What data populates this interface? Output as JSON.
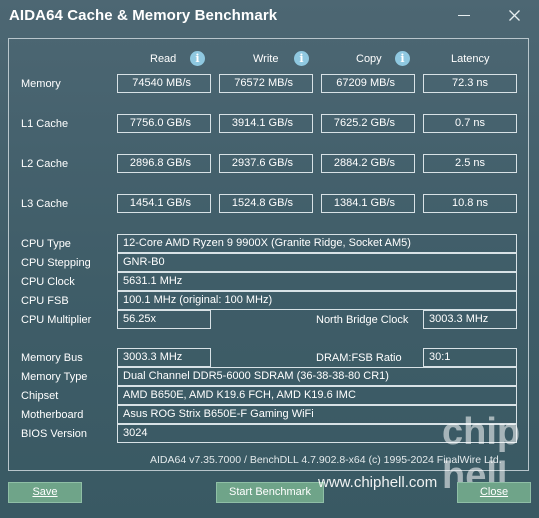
{
  "window": {
    "title": "AIDA64 Cache & Memory Benchmark"
  },
  "columns": {
    "read": "Read",
    "write": "Write",
    "copy": "Copy",
    "latency": "Latency"
  },
  "rows": [
    {
      "label": "Memory",
      "read": "74540 MB/s",
      "write": "76572 MB/s",
      "copy": "67209 MB/s",
      "latency": "72.3 ns"
    },
    {
      "label": "L1 Cache",
      "read": "7756.0 GB/s",
      "write": "3914.1 GB/s",
      "copy": "7625.2 GB/s",
      "latency": "0.7 ns"
    },
    {
      "label": "L2 Cache",
      "read": "2896.8 GB/s",
      "write": "2937.6 GB/s",
      "copy": "2884.2 GB/s",
      "latency": "2.5 ns"
    },
    {
      "label": "L3 Cache",
      "read": "1454.1 GB/s",
      "write": "1524.8 GB/s",
      "copy": "1384.1 GB/s",
      "latency": "10.8 ns"
    }
  ],
  "cpu": {
    "type_label": "CPU Type",
    "type": "12-Core AMD Ryzen 9 9900X  (Granite Ridge, Socket AM5)",
    "stepping_label": "CPU Stepping",
    "stepping": "GNR-B0",
    "clock_label": "CPU Clock",
    "clock": "5631.1 MHz",
    "fsb_label": "CPU FSB",
    "fsb": "100.1 MHz  (original: 100 MHz)",
    "multiplier_label": "CPU Multiplier",
    "multiplier": "56.25x",
    "nb_clock_label": "North Bridge Clock",
    "nb_clock": "3003.3 MHz"
  },
  "memory": {
    "bus_label": "Memory Bus",
    "bus": "3003.3 MHz",
    "ratio_label": "DRAM:FSB Ratio",
    "ratio": "30:1",
    "type_label": "Memory Type",
    "type": "Dual Channel DDR5-6000 SDRAM  (36-38-38-80 CR1)",
    "chipset_label": "Chipset",
    "chipset": "AMD B650E, AMD K19.6 FCH, AMD K19.6 IMC",
    "motherboard_label": "Motherboard",
    "motherboard": "Asus ROG Strix B650E-F Gaming WiFi",
    "bios_label": "BIOS Version",
    "bios": "3024"
  },
  "footer": {
    "version": "AIDA64 v7.35.7000 / BenchDLL 4.7.902.8-x64  (c) 1995-2024 FinalWire Ltd."
  },
  "buttons": {
    "save": "Save",
    "start": "Start Benchmark",
    "close": "Close"
  },
  "watermark": {
    "text": "www.chiphell.com",
    "logo": "chip hell"
  },
  "icons": {
    "info": "info-icon",
    "minimize": "minimize-icon",
    "close": "close-icon"
  }
}
